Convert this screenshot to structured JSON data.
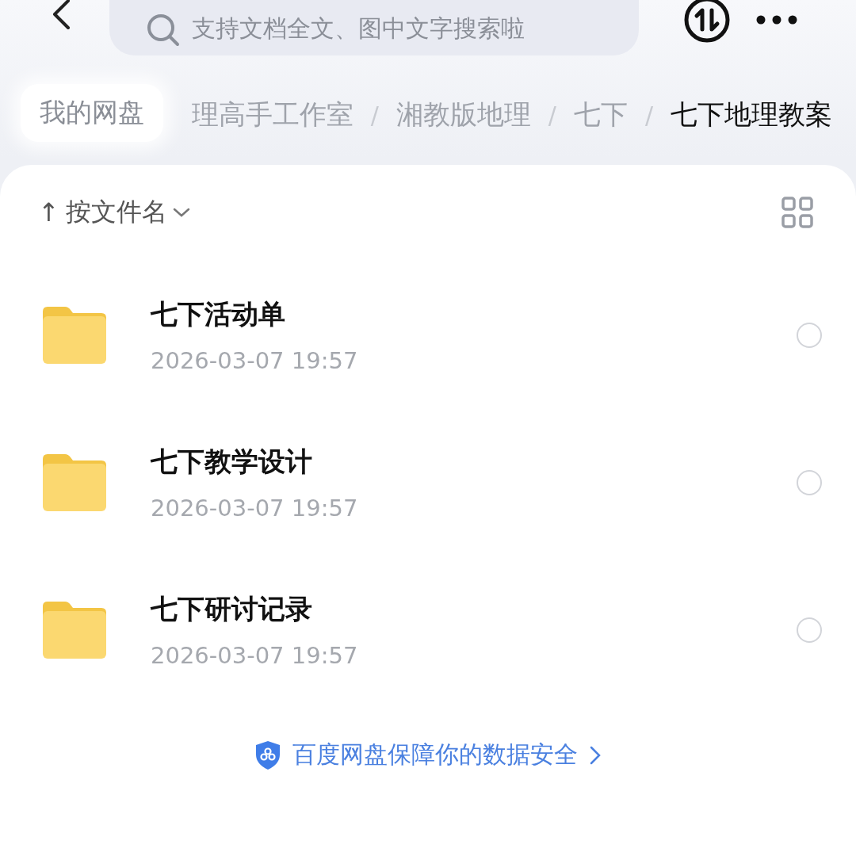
{
  "search": {
    "placeholder": "支持文档全文、图中文字搜索啦"
  },
  "breadcrumb": {
    "root": "我的网盘",
    "items": [
      {
        "kind": "folder",
        "label": "理高手工作室",
        "selected": false
      },
      {
        "kind": "separator",
        "label": "/"
      },
      {
        "kind": "folder",
        "label": "湘教版地理",
        "selected": false
      },
      {
        "kind": "separator",
        "label": "/"
      },
      {
        "kind": "folder",
        "label": "七下",
        "selected": false
      },
      {
        "kind": "separator",
        "label": "/"
      },
      {
        "kind": "folder",
        "label": "七下地理教案",
        "selected": true
      }
    ]
  },
  "sort": {
    "arrow": "↑",
    "label": "按文件名"
  },
  "files": [
    {
      "name": "七下活动单",
      "date": "2026-03-07 19:57",
      "checked": false
    },
    {
      "name": "七下教学设计",
      "date": "2026-03-07 19:57",
      "checked": false
    },
    {
      "name": "七下研讨记录",
      "date": "2026-03-07 19:57",
      "checked": false
    }
  ],
  "footer": {
    "label": "百度网盘保障你的数据安全"
  }
}
